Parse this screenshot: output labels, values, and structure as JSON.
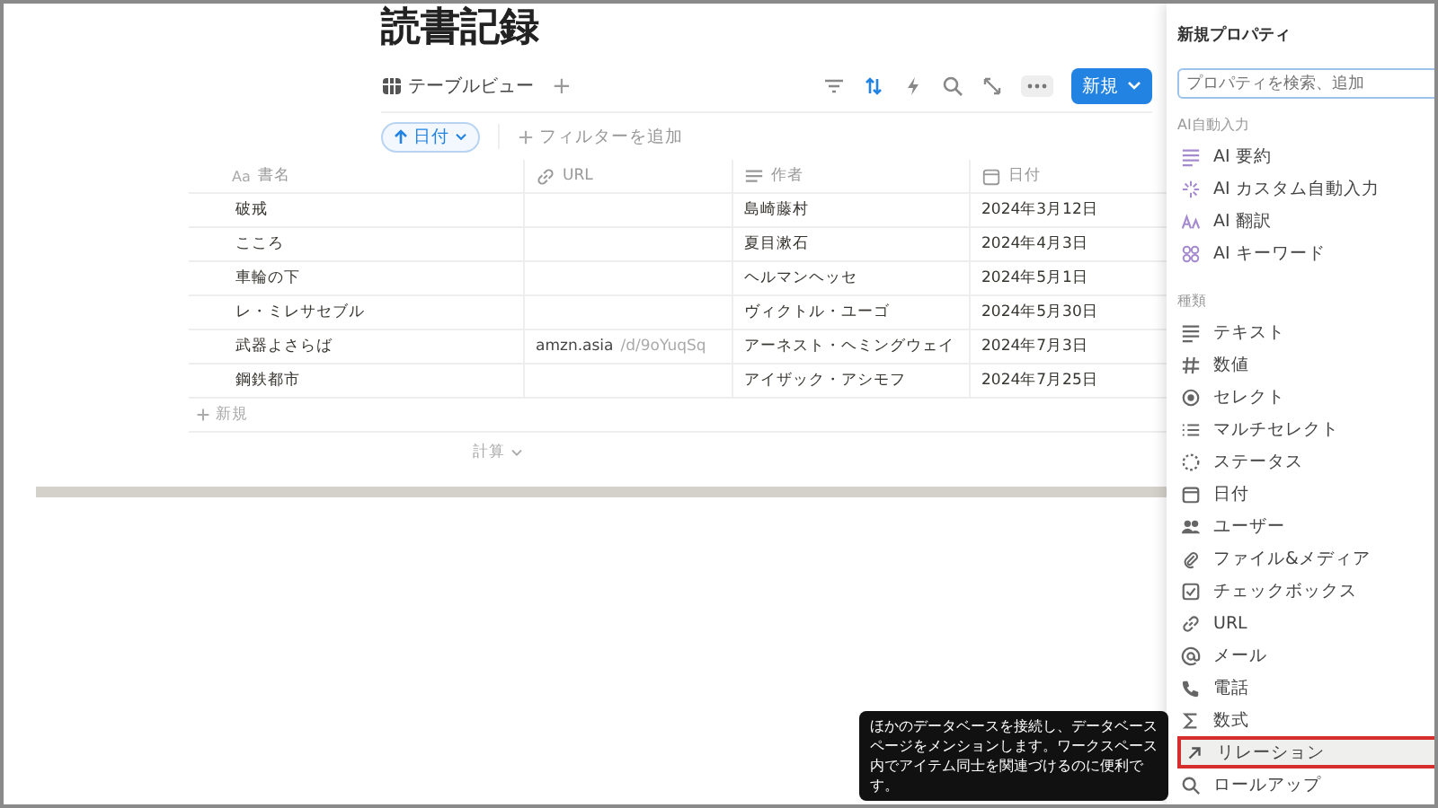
{
  "page": {
    "title": "読書記録"
  },
  "view_tab": {
    "label": "テーブルビュー",
    "add": "+"
  },
  "toolbar": {
    "new_button": "新規"
  },
  "sort_chip": {
    "label": "日付"
  },
  "add_filter": "フィルターを追加",
  "table": {
    "columns": [
      {
        "label": "書名",
        "prefix": "Aa"
      },
      {
        "label": "URL"
      },
      {
        "label": "作者"
      },
      {
        "label": "日付"
      }
    ],
    "rows": [
      {
        "title": "破戒",
        "url": "",
        "author": "島崎藤村",
        "date": "2024年3月12日"
      },
      {
        "title": "こころ",
        "url": "",
        "author": "夏目漱石",
        "date": "2024年4月3日"
      },
      {
        "title": "車輪の下",
        "url": "",
        "author": "ヘルマンヘッセ",
        "date": "2024年5月1日"
      },
      {
        "title": "レ・ミレサセブル",
        "url": "",
        "author": "ヴィクトル・ユーゴ",
        "date": "2024年5月30日"
      },
      {
        "title": "武器よさらば",
        "url": "amzn.asia",
        "url_rest": "/d/9oYuqSq",
        "author": "アーネスト・ヘミングウェイ",
        "date": "2024年7月3日"
      },
      {
        "title": "鋼鉄都市",
        "url": "",
        "author": "アイザック・アシモフ",
        "date": "2024年7月25日"
      }
    ],
    "new_row": "新規",
    "calc": "計算"
  },
  "panel": {
    "title": "新規プロパティ",
    "search": {
      "placeholder": "プロパティを検索、追加"
    },
    "ai_section": "AI自動入力",
    "ai_items": [
      {
        "label": "AI 要約",
        "selected": false
      },
      {
        "label": "AI カスタム自動入力",
        "selected": false
      },
      {
        "label": "AI 翻訳",
        "selected": false
      },
      {
        "label": "AI キーワード",
        "selected": false
      }
    ],
    "types_section": "種類",
    "types": [
      {
        "label": "テキスト",
        "selected": false
      },
      {
        "label": "数値",
        "selected": false
      },
      {
        "label": "セレクト",
        "selected": false
      },
      {
        "label": "マルチセレクト",
        "selected": false
      },
      {
        "label": "ステータス",
        "selected": false
      },
      {
        "label": "日付",
        "selected": false
      },
      {
        "label": "ユーザー",
        "selected": false
      },
      {
        "label": "ファイル&メディア",
        "selected": false
      },
      {
        "label": "チェックボックス",
        "selected": false
      },
      {
        "label": "URL",
        "selected": false
      },
      {
        "label": "メール",
        "selected": false
      },
      {
        "label": "電話",
        "selected": false
      },
      {
        "label": "数式",
        "selected": false
      },
      {
        "label": "リレーション",
        "selected": true
      },
      {
        "label": "ロールアップ",
        "selected": false
      }
    ]
  },
  "tooltip": "ほかのデータベースを接続し、データベースページをメンションします。ワークスペース内でアイテム同士を関連づけるのに便利です。"
}
